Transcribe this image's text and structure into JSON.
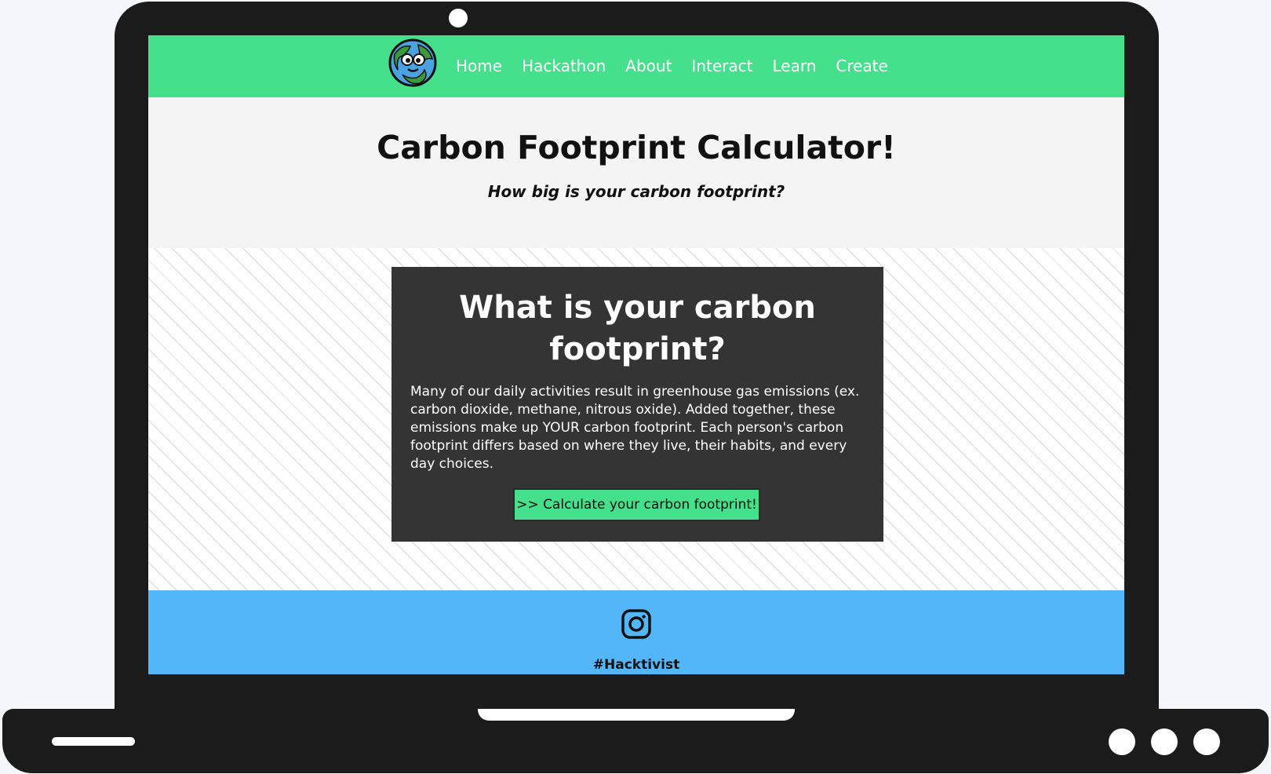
{
  "nav": {
    "links": [
      "Home",
      "Hackathon",
      "About",
      "Interact",
      "Learn",
      "Create"
    ]
  },
  "hero": {
    "title": "Carbon Footprint Calculator!",
    "subtitle": "How big is your carbon footprint?"
  },
  "card": {
    "title": "What is your carbon footprint?",
    "body": "Many of our daily activities result in greenhouse gas emissions (ex. carbon dioxide, methane, nitrous oxide). Added together, these emissions make up YOUR carbon footprint. Each person's carbon footprint differs based on where they live, their habits, and every day choices.",
    "button_label": ">> Calculate your carbon footprint!"
  },
  "footer": {
    "icon": "instagram-icon",
    "hashtag": "#Hacktivist"
  },
  "colors": {
    "nav_green": "#45e08b",
    "footer_blue": "#52b6f8",
    "card_bg": "#343434",
    "frame": "#1b1b1b"
  }
}
